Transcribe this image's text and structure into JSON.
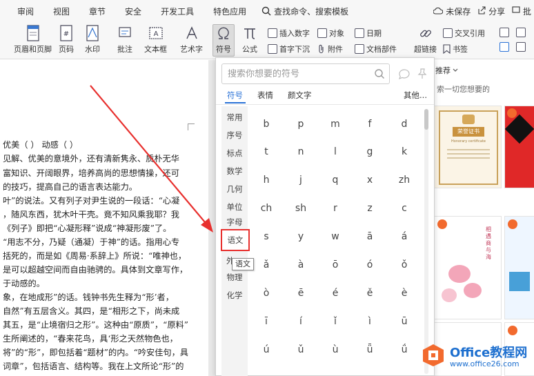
{
  "menubar": {
    "items": [
      "审阅",
      "视图",
      "章节",
      "安全",
      "开发工具",
      "特色应用"
    ],
    "search_label": "查找命令、搜索模板",
    "right": {
      "unsaved": "未保存",
      "share": "分享",
      "batch": "批"
    }
  },
  "ribbon": {
    "header_footer": "页眉和页脚",
    "page_number": "页码",
    "watermark": "水印",
    "comment": "批注",
    "textbox": "文本框",
    "wordart": "艺术字",
    "symbol": "符号",
    "formula": "公式",
    "insert_number": "插入数字",
    "object": "对象",
    "date": "日期",
    "dropcap": "首字下沉",
    "attachment": "附件",
    "doc_parts": "文档部件",
    "hyperlink": "超链接",
    "cross_ref": "交叉引用",
    "bookmark": "书签"
  },
  "document": {
    "lines": [
      "    优美（       ）          动感（       ）",
      "见解、优美的意境外，还有清新隽永、质朴无华",
      "富知识、开阔眼界，培养高尚的思想情操，还可",
      "的技巧，提高自己的语言表达能力。",
      "叶”的说法。又有列子对尹生说的一段话：“心凝",
      "，随风东西，犹木叶干壳。竟不知风乘我耶？我",
      "《列子》即把“心凝形释”说成“神凝形废”了。",
      "“用志不分，乃疑（通凝）于神”的话。指用心专",
      "括死的，而是如《周易·系辞上》所说：“唯神也，",
      "是可以超越空间而自由驰骋的。具体到文章写作，",
      "于动感的。",
      "象，在地成形”的话。钱钟书先生释为“形’者，",
      "自然”有五层含义。其四，是“相形之下，尚未成",
      "其五，是“止境宿归之形”。这种由“原质”，“原料”",
      "生所阐述的，“春来花鸟，具‘形之天然物色也，",
      "将”的“形”，即包括着“题材”的内。“吟安佳句，具",
      "词章”，包括语言、结构等。我在上文所论“形”的"
    ]
  },
  "symbol_panel": {
    "search_placeholder": "搜索你想要的符号",
    "tabs": [
      "符号",
      "表情",
      "颜文字"
    ],
    "more": "其他...",
    "categories": [
      "常用",
      "序号",
      "标点",
      "数学",
      "几何",
      "单位",
      "字母",
      "语文",
      "外",
      "物理",
      "化学"
    ],
    "active_category": "语文",
    "tooltip": "语文",
    "symbols": [
      [
        "b",
        "p",
        "m",
        "f",
        "d"
      ],
      [
        "t",
        "n",
        "l",
        "g",
        "k"
      ],
      [
        "h",
        "j",
        "q",
        "x",
        "zh"
      ],
      [
        "ch",
        "sh",
        "r",
        "z",
        "c"
      ],
      [
        "s",
        "y",
        "w",
        "ā",
        "á"
      ],
      [
        "ǎ",
        "à",
        "ō",
        "ó",
        "ǒ"
      ],
      [
        "ò",
        "ē",
        "é",
        "ě",
        "è"
      ],
      [
        "ī",
        "í",
        "ǐ",
        "ì",
        "ū"
      ],
      [
        "ú",
        "ǔ",
        "ù",
        "ǖ",
        "ǘ"
      ]
    ]
  },
  "template_pane": {
    "tab_label": "推荐",
    "hint": "索一切您想要的",
    "cert_title": "荣誉证书",
    "cert_subtitle": "Honorary certificate",
    "flower_text": "相遇商与海"
  },
  "watermark_logo": {
    "brand": "Office教程网",
    "url": "www.office26.com"
  },
  "colors": {
    "accent_blue": "#2a72d6",
    "highlight_red": "#e8302e",
    "logo_orange": "#f26a2e"
  }
}
